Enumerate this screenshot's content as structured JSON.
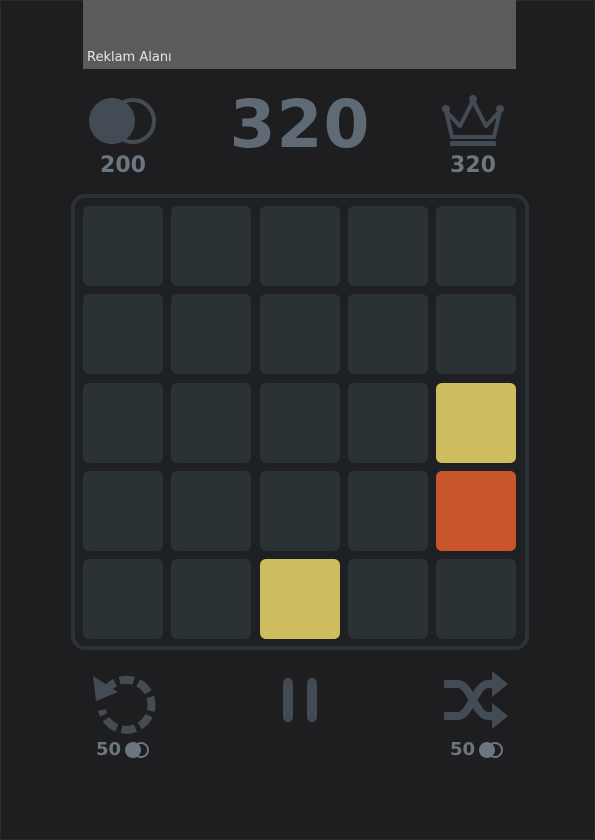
{
  "ad": {
    "label": "Reklam Alanı"
  },
  "header": {
    "coins": "200",
    "score": "320",
    "best_score": "320"
  },
  "icons": {
    "coin": "coin-icon",
    "crown": "crown-icon",
    "undo": "undo-icon",
    "pause": "pause-icon",
    "shuffle": "shuffle-icon"
  },
  "board": {
    "rows": 5,
    "cols": 5,
    "tiles": [
      {
        "row": 2,
        "col": 4,
        "color": "#cdbd5e"
      },
      {
        "row": 3,
        "col": 4,
        "color": "#c9552d"
      },
      {
        "row": 4,
        "col": 2,
        "color": "#cdbd5e"
      }
    ]
  },
  "actions": {
    "undo_cost": "50",
    "shuffle_cost": "50"
  },
  "colors": {
    "background": "#1e1e20",
    "cell": "#2b3236",
    "text": "#6b7680",
    "yellow_tile": "#cdbd5e",
    "orange_tile": "#c9552d"
  }
}
